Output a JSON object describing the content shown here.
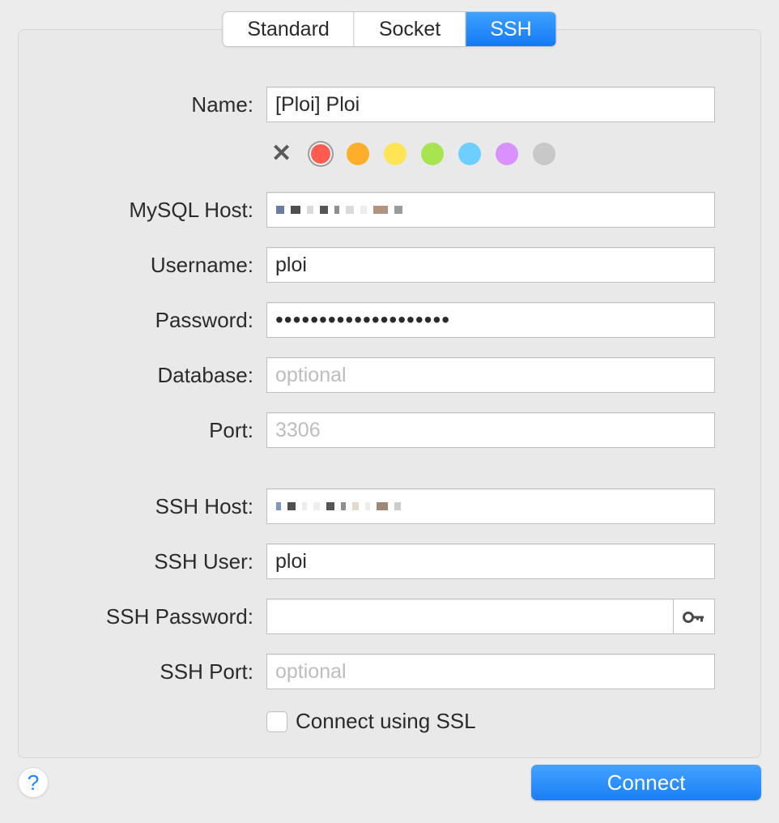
{
  "tabs": {
    "t0": "Standard",
    "t1": "Socket",
    "t2": "SSH"
  },
  "labels": {
    "name": "Name:",
    "mysql_host": "MySQL Host:",
    "username": "Username:",
    "password": "Password:",
    "database": "Database:",
    "port": "Port:",
    "ssh_host": "SSH Host:",
    "ssh_user": "SSH User:",
    "ssh_password": "SSH Password:",
    "ssh_port": "SSH Port:",
    "ssl_check": "Connect using SSL"
  },
  "values": {
    "name": "[Ploi] Ploi",
    "username": "ploi",
    "password_masked": "••••••••••••••••••••",
    "database": "",
    "port": "",
    "ssh_user": "ploi",
    "ssh_password": "",
    "ssh_port": ""
  },
  "placeholders": {
    "database": "optional",
    "port": "3306",
    "ssh_port": "optional"
  },
  "colors": {
    "red": "#ff5b4f",
    "orange": "#ffae2b",
    "yellow": "#ffe455",
    "green": "#a8e44f",
    "blue": "#6ccfff",
    "purple": "#d991ff",
    "gray": "#c8c8c8"
  },
  "buttons": {
    "connect": "Connect",
    "help": "?"
  }
}
